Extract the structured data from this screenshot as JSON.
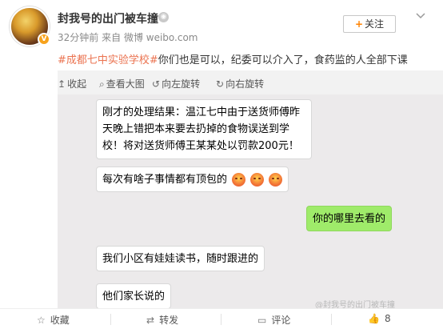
{
  "header": {
    "username": "封我号的出门被车撞",
    "time": "32分钟前",
    "source_prefix": "来自",
    "source": "微博 weibo.com",
    "follow_label": "关注"
  },
  "post": {
    "topic": "#成都七中实验学校#",
    "text": "你们也是可以，纪委可以介入了，食药监的人全部下课"
  },
  "toolbar": {
    "collapse": "收起",
    "view_large": "查看大图",
    "rotate_left": "向左旋转",
    "rotate_right": "向右旋转"
  },
  "chat": {
    "msg1": "刚才的处理结果：温江七中由于送货师傅昨天晚上错把本来要去扔掉的食物误送到学校！将对送货师傅王某某处以罚款200元！",
    "msg2": "每次有啥子事情都有顶包的",
    "msg3": "你的哪里去看的",
    "msg4": "我们小区有娃娃读书，随时跟进的",
    "msg5": "他们家长说的",
    "watermark": "@封我号的出门被车撞"
  },
  "actions": {
    "collect": "收藏",
    "repost": "转发",
    "comment": "评论",
    "like_count": "8"
  },
  "colors": {
    "topic": "#eb7350",
    "follow_plus": "#ff8200",
    "green_bubble": "#9feb6a"
  }
}
